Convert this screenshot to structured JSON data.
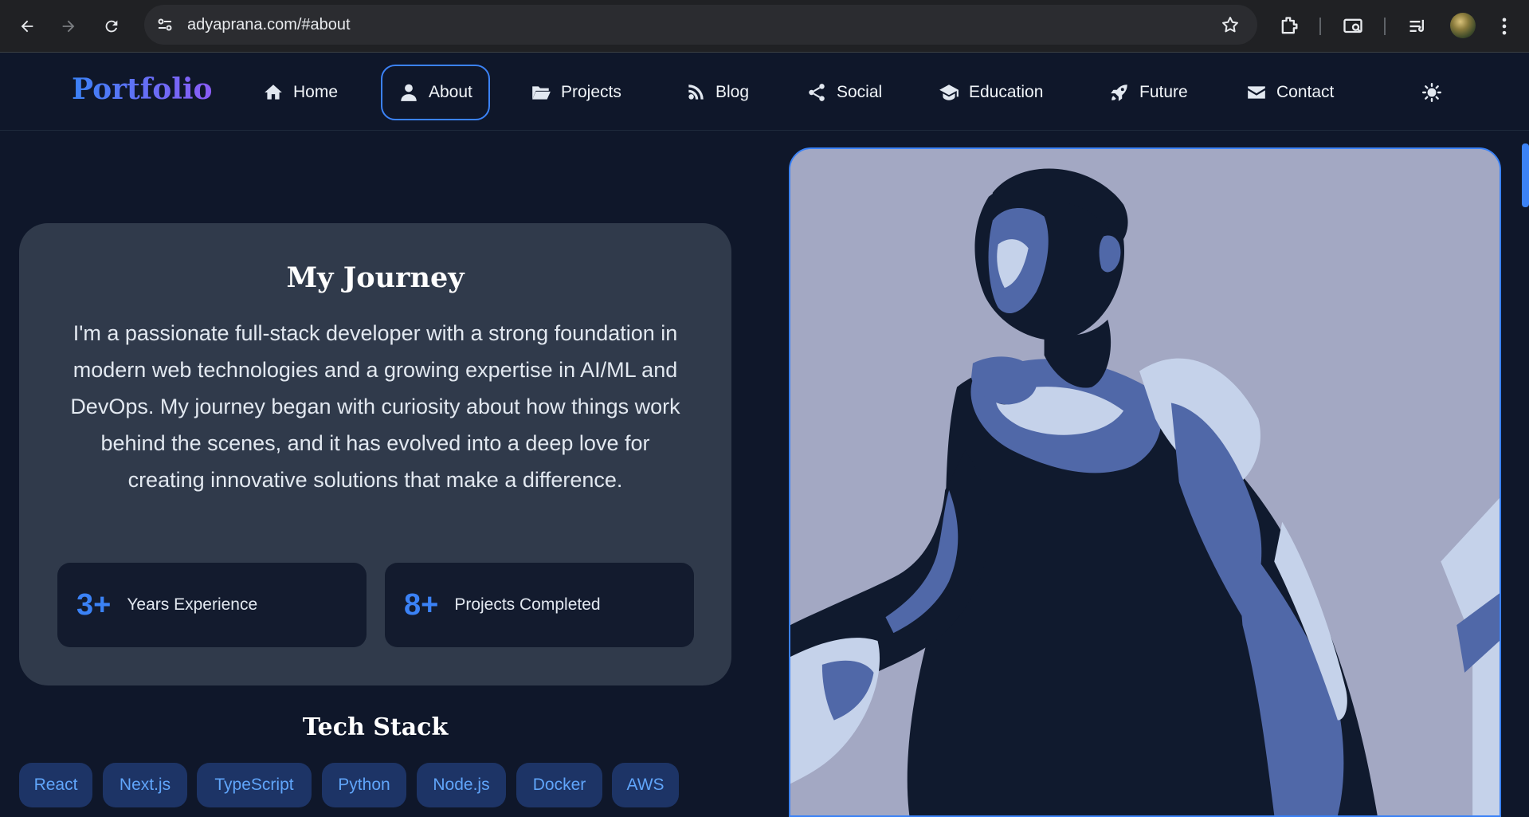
{
  "browser": {
    "url": "adyaprana.com/#about"
  },
  "nav": {
    "brand": "Portfolio",
    "items": [
      {
        "label": "Home",
        "icon": "home-icon"
      },
      {
        "label": "About",
        "icon": "user-icon"
      },
      {
        "label": "Projects",
        "icon": "folder-icon"
      },
      {
        "label": "Blog",
        "icon": "blog-icon"
      },
      {
        "label": "Social",
        "icon": "share-icon"
      },
      {
        "label": "Education",
        "icon": "graduation-cap-icon"
      },
      {
        "label": "Future",
        "icon": "rocket-icon"
      },
      {
        "label": "Contact",
        "icon": "envelope-icon"
      }
    ],
    "active": "About"
  },
  "journey": {
    "title": "My Journey",
    "text": "I'm a passionate full-stack developer with a strong foundation in modern web technologies and a growing expertise in AI/ML and DevOps. My journey began with curiosity about how things work behind the scenes, and it has evolved into a deep love for creating innovative solutions that make a difference.",
    "stats": [
      {
        "value": "3+",
        "label": "Years Experience"
      },
      {
        "value": "8+",
        "label": "Projects Completed"
      }
    ]
  },
  "tech": {
    "title": "Tech Stack",
    "items": [
      "React",
      "Next.js",
      "TypeScript",
      "Python",
      "Node.js",
      "Docker",
      "AWS"
    ]
  },
  "colors": {
    "accent": "#3b82f6",
    "background": "#0f172a",
    "card": "#303a4b"
  }
}
